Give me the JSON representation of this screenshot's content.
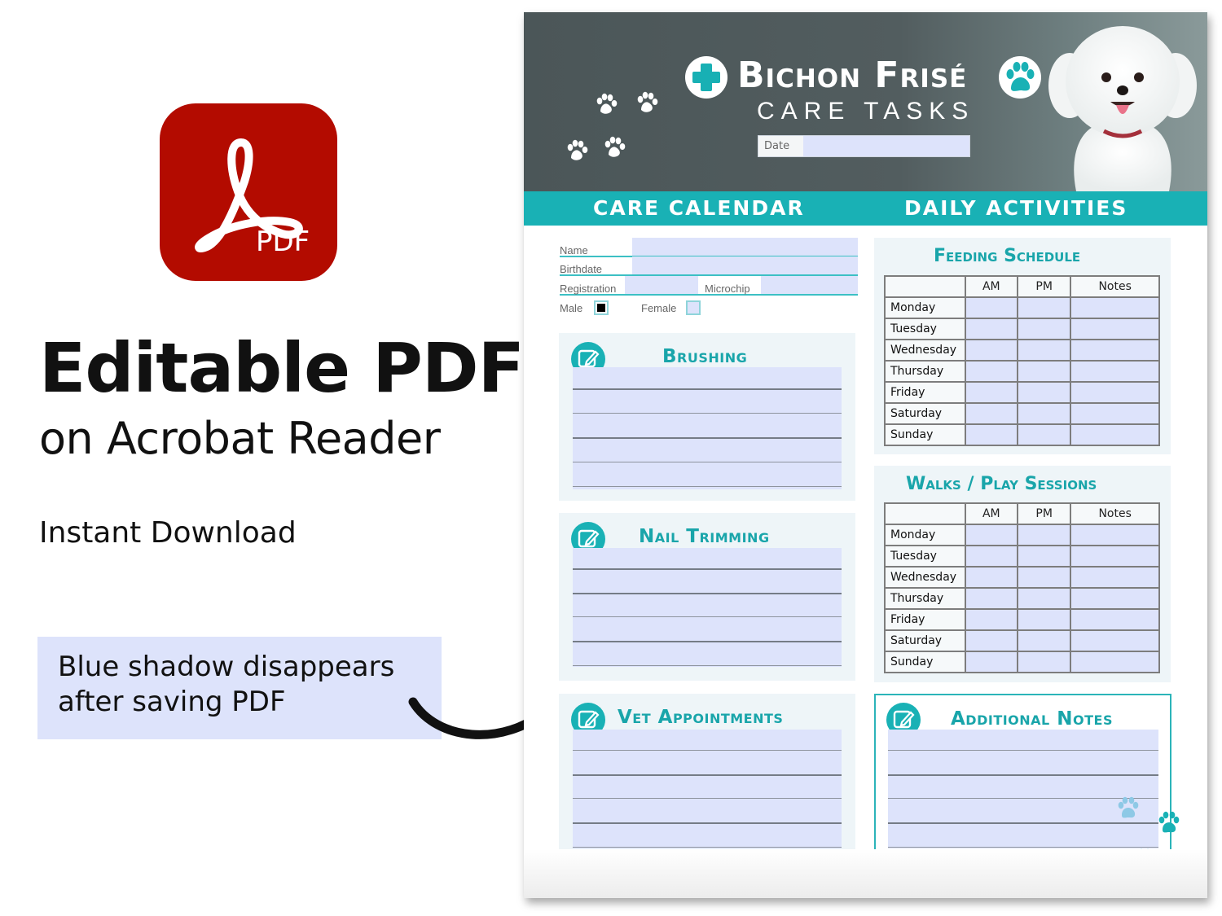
{
  "promo": {
    "app_icon_label": "PDF",
    "headline": "Editable PDF",
    "subheadline": "on Acrobat Reader",
    "tagline": "Instant Download",
    "callout_lines": [
      "Blue shadow disappears",
      "after saving PDF"
    ]
  },
  "header": {
    "brand": "Bichon Frisé",
    "subtitle": "CARE TASKS",
    "date_label": "Date",
    "date_value": ""
  },
  "bands": {
    "left": "CARE CALENDAR",
    "right": "DAILY ACTIVITIES"
  },
  "profile": {
    "name_label": "Name",
    "birthdate_label": "Birthdate",
    "registration_label": "Registration",
    "microchip_label": "Microchip",
    "male_label": "Male",
    "female_label": "Female",
    "male_checked": true,
    "female_checked": false
  },
  "care_sections": [
    {
      "title": "Brushing"
    },
    {
      "title": "Nail Trimming"
    },
    {
      "title": "Vet Appointments"
    }
  ],
  "additional_notes": {
    "title": "Additional Notes"
  },
  "feeding": {
    "title": "Feeding Schedule",
    "columns": [
      "",
      "AM",
      "PM",
      "Notes"
    ],
    "days": [
      "Monday",
      "Tuesday",
      "Wednesday",
      "Thursday",
      "Friday",
      "Saturday",
      "Sunday"
    ]
  },
  "walks": {
    "title": "Walks / Play Sessions",
    "columns": [
      "",
      "AM",
      "PM",
      "Notes"
    ],
    "days": [
      "Monday",
      "Tuesday",
      "Wednesday",
      "Thursday",
      "Friday",
      "Saturday",
      "Sunday"
    ]
  },
  "colors": {
    "teal": "#19b1b5",
    "field_blue": "#dde3fb",
    "acrobat_red": "#b30b00",
    "header_gray": "#4b5658"
  }
}
